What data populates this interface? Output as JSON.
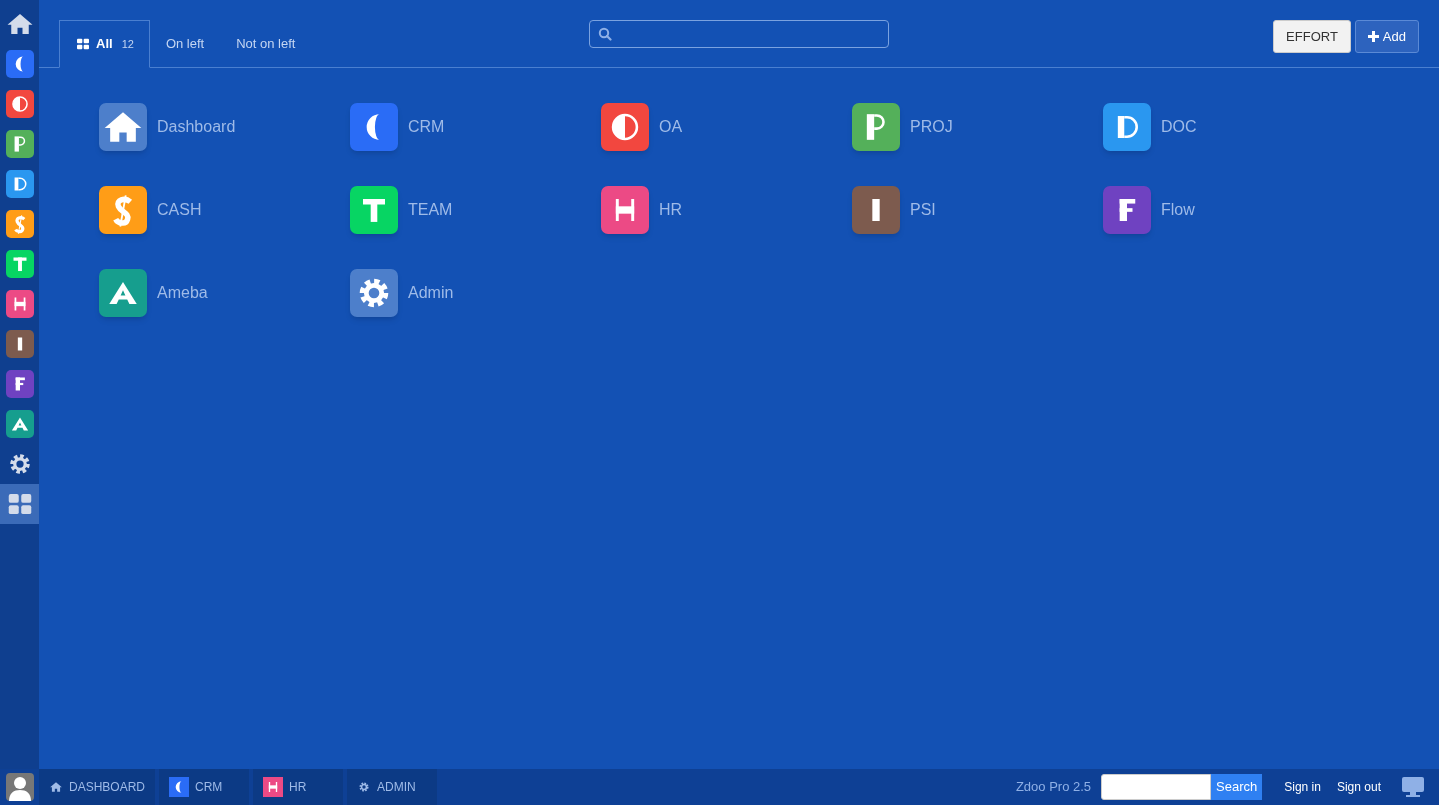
{
  "sidebar": {
    "items": [
      {
        "kind": "home",
        "selected": false
      },
      {
        "kind": "crm",
        "color": "#2a6cf6",
        "selected": false
      },
      {
        "kind": "oa",
        "color": "#f2473f",
        "selected": false
      },
      {
        "kind": "proj",
        "color": "#54b05a",
        "selected": false
      },
      {
        "kind": "doc",
        "color": "#2a97f0",
        "selected": false
      },
      {
        "kind": "cash",
        "color": "#ff9d17",
        "selected": false
      },
      {
        "kind": "team",
        "color": "#07d563",
        "selected": false
      },
      {
        "kind": "hr",
        "color": "#ec4a85",
        "selected": false
      },
      {
        "kind": "psi",
        "color": "#7d5b4e",
        "selected": false
      },
      {
        "kind": "flow",
        "color": "#6f42c1",
        "selected": false
      },
      {
        "kind": "ameba",
        "color": "#169e8e",
        "selected": false
      },
      {
        "kind": "gear",
        "selected": false
      },
      {
        "kind": "grid",
        "selected": true
      }
    ]
  },
  "tabs": [
    {
      "label": "All",
      "kind": "all",
      "count": "12",
      "selected": true
    },
    {
      "label": "On left",
      "kind": "filter",
      "selected": false
    },
    {
      "label": "Not on left",
      "kind": "filter",
      "selected": false
    }
  ],
  "buttons": [
    {
      "label": "EFFORT",
      "kind": "plain"
    },
    {
      "label": "Add",
      "kind": "add"
    }
  ],
  "apps": [
    {
      "name": "Dashboard",
      "kind": "home",
      "color": "#4d7fcb"
    },
    {
      "name": "CRM",
      "kind": "crm",
      "color": "#2a6cf6"
    },
    {
      "name": "OA",
      "kind": "oa",
      "color": "#f2473f"
    },
    {
      "name": "PROJ",
      "kind": "proj",
      "color": "#54b05a"
    },
    {
      "name": "DOC",
      "kind": "doc",
      "color": "#2a97f0"
    },
    {
      "name": "CASH",
      "kind": "cash",
      "color": "#ff9d17"
    },
    {
      "name": "TEAM",
      "kind": "team",
      "color": "#07d563"
    },
    {
      "name": "HR",
      "kind": "hr",
      "color": "#ec4a85"
    },
    {
      "name": "PSI",
      "kind": "psi",
      "color": "#7d5b4e"
    },
    {
      "name": "Flow",
      "kind": "flow",
      "color": "#6f42c1"
    },
    {
      "name": "Ameba",
      "kind": "ameba",
      "color": "#169e8e"
    },
    {
      "name": "Admin",
      "kind": "gear",
      "color": "#4d7fcb"
    }
  ],
  "taskbar": {
    "items": [
      {
        "label": "DASHBOARD",
        "kind": "home"
      },
      {
        "label": "CRM",
        "kind": "crm",
        "color": "#2a6cf6"
      },
      {
        "label": "HR",
        "kind": "hr",
        "color": "#ec4a85"
      },
      {
        "label": "ADMIN",
        "kind": "gear"
      }
    ],
    "version": "Zdoo Pro 2.5",
    "search_button": "Search",
    "links": [
      "Sign in",
      "Sign out"
    ]
  }
}
